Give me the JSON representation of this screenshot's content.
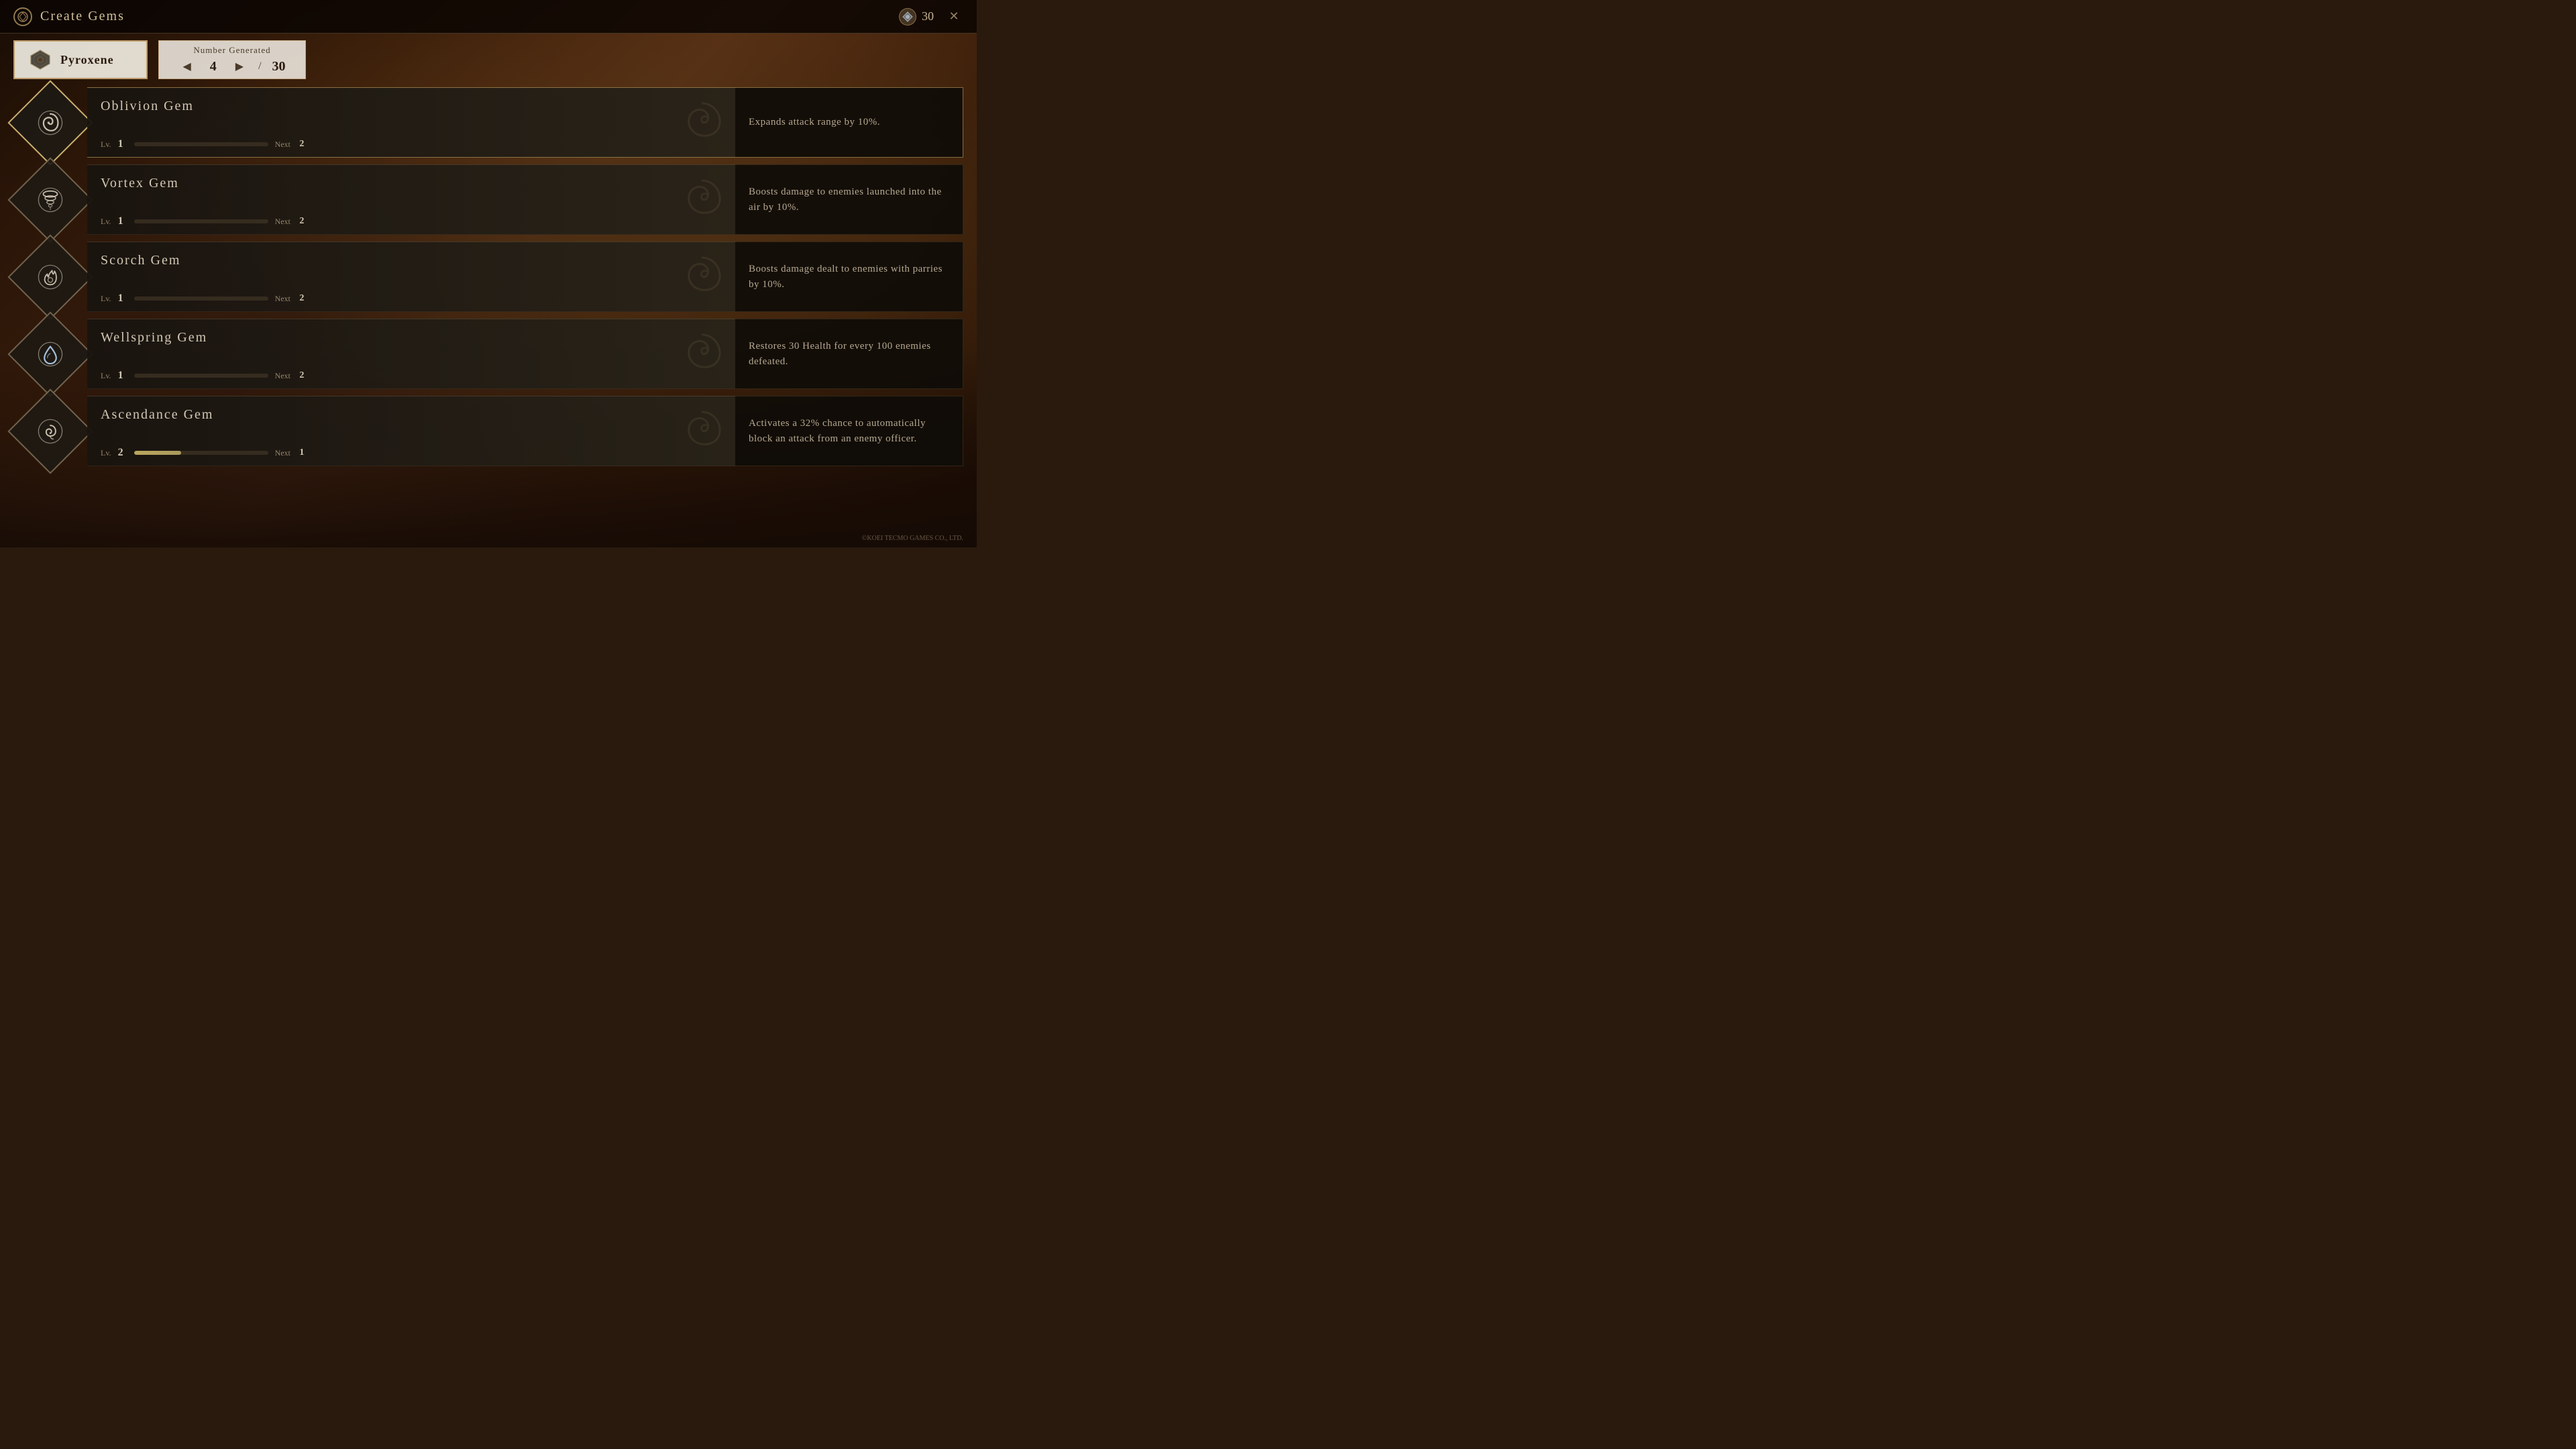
{
  "topBar": {
    "title": "Create Gems",
    "titleIcon": "⬡",
    "currency": {
      "icon": "❄",
      "amount": "30"
    },
    "closeIcon": "✕"
  },
  "material": {
    "name": "Pyroxene",
    "icon": "◈"
  },
  "numberControl": {
    "label": "Number Generated",
    "value": "4",
    "max": "30",
    "prevArrow": "◀",
    "nextArrow": "▶"
  },
  "gems": [
    {
      "id": "oblivion",
      "name": "Oblivion Gem",
      "level": 1,
      "nextLevel": 2,
      "progress": 0,
      "description": "Expands attack range by 10%.",
      "selected": true,
      "iconType": "spiral"
    },
    {
      "id": "vortex",
      "name": "Vortex Gem",
      "level": 1,
      "nextLevel": 2,
      "progress": 0,
      "description": "Boosts damage to enemies launched into the air by 10%.",
      "selected": false,
      "iconType": "tornado"
    },
    {
      "id": "scorch",
      "name": "Scorch Gem",
      "level": 1,
      "nextLevel": 2,
      "progress": 0,
      "description": "Boosts damage dealt to enemies with parries by 10%.",
      "selected": false,
      "iconType": "flame"
    },
    {
      "id": "wellspring",
      "name": "Wellspring Gem",
      "level": 1,
      "nextLevel": 2,
      "progress": 0,
      "description": "Restores 30 Health for every 100 enemies defeated.",
      "selected": false,
      "iconType": "drop"
    },
    {
      "id": "ascendance",
      "name": "Ascendance Gem",
      "level": 2,
      "nextLevel": 1,
      "progress": 35,
      "description": "Activates a 32% chance to automatically block an attack from an enemy officer.",
      "selected": false,
      "iconType": "swirl"
    }
  ],
  "copyright": "©KOEI TECMO GAMES CO., LTD."
}
